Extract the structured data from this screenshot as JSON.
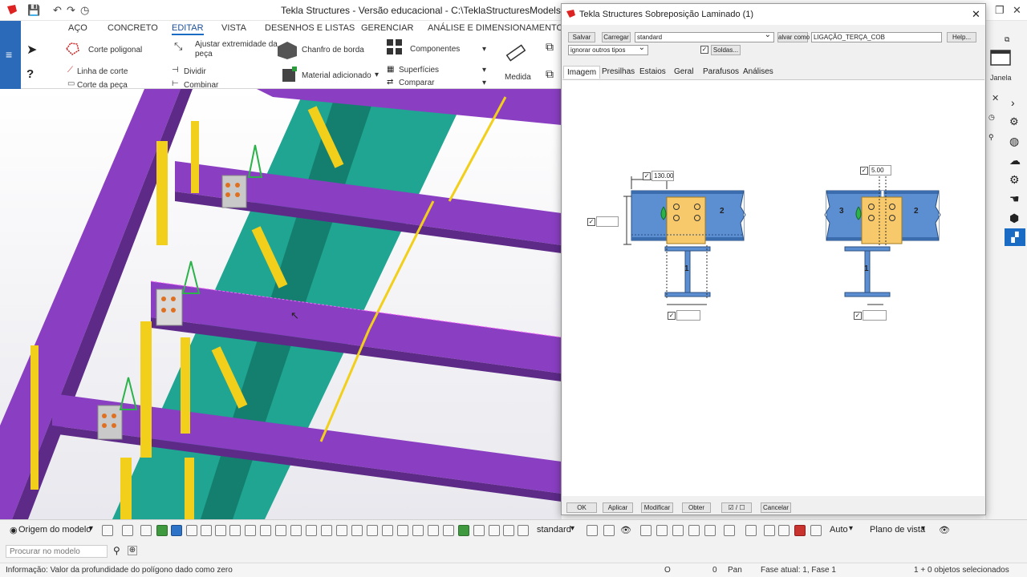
{
  "window": {
    "title": "Tekla Structures - Versão educacional - C:\\TeklaStructuresModels\\Treinament"
  },
  "ribbon": {
    "tabs": [
      "AÇO",
      "CONCRETO",
      "EDITAR",
      "VISTA",
      "DESENHOS E LISTAS",
      "GERENCIAR",
      "ANÁLISE E DIMENSIONAMENTO"
    ],
    "active_tab": "EDITAR",
    "commands": {
      "corte_poligonal": "Corte poligonal",
      "linha_de_corte": "Linha de corte",
      "corte_da_peca": "Corte da peça",
      "ajustar": "Ajustar extremidade da",
      "ajustar2": "peça",
      "dividir": "Dividir",
      "combinar": "Combinar",
      "chanfro": "Chanfro de borda",
      "material": "Material adicionado",
      "componentes": "Componentes",
      "superficies": "Superfícies",
      "comparar": "Comparar",
      "medida": "Medida"
    }
  },
  "right_panel": {
    "janela": "Janela"
  },
  "dialog": {
    "title": "Tekla Structures  Sobreposição Laminado (1)",
    "buttons": {
      "salvar": "Salvar",
      "carregar": "Carregar",
      "salvar_como": "alvar como",
      "help": "Help...",
      "soldas": "Soldas..."
    },
    "preset": "standard",
    "save_as_name": "LIGAÇÃO_TERÇA_COB",
    "ignore_types": "ignorar outros tipos",
    "tabs": [
      "Imagem",
      "Presilhas",
      "Estaios",
      "Geral",
      "Parafusos",
      "Análises"
    ],
    "active_tab": "Imagem",
    "diagram": {
      "left_dim": "130.00",
      "right_dim": "5.00",
      "labels": [
        "1",
        "2",
        "3"
      ]
    },
    "footer": {
      "ok": "OK",
      "aplicar": "Aplicar",
      "modificar": "Modificar",
      "obter": "Obter",
      "toggle": "☑ / ☐",
      "cancelar": "Cancelar"
    }
  },
  "bottom_toolbar": {
    "origin": "Origem do modelo",
    "standard": "standard",
    "auto": "Auto",
    "plano": "Plano de vista"
  },
  "search": {
    "placeholder": "Procurar no modelo"
  },
  "status": {
    "info": "Informação: Valor da profundidade do polígono dado como zero",
    "o": "O",
    "zero": "0",
    "pan": "Pan",
    "fase": "Fase atual: 1, Fase 1",
    "selected": "1 + 0 objetos selecionados"
  },
  "colors": {
    "steel_purple": "#8a3fc2",
    "steel_teal": "#1fa591",
    "steel_yellow": "#f2cf1a",
    "plate_blue": "#5b8fd2",
    "plate_orange": "#f7c96a"
  }
}
